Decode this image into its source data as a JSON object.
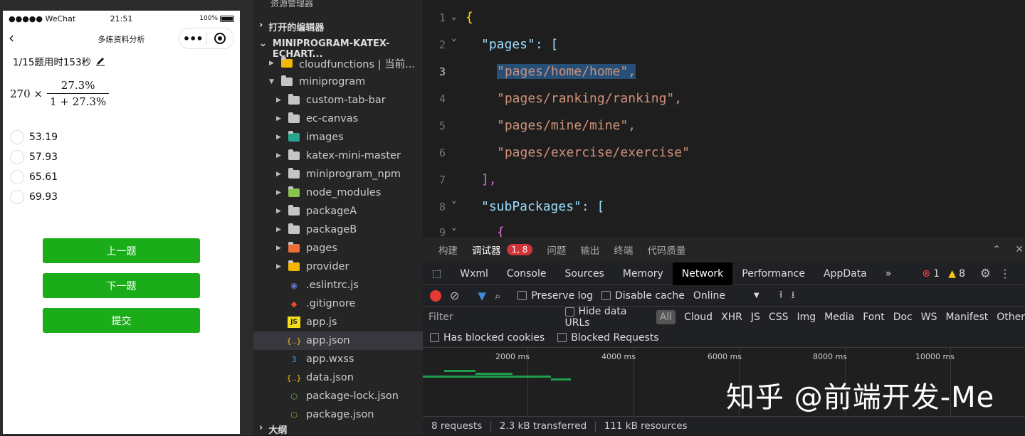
{
  "simulator": {
    "statusbar": {
      "carrier": "●●●●● WeChat",
      "time": "21:51",
      "battery": "100%"
    },
    "navbar": {
      "title": "多练资料分析",
      "back_icon": "chevron-left-icon",
      "more_icon": "more-dots-icon",
      "close_icon": "record-icon"
    },
    "question_info": "1/15题用时153秒",
    "formula": {
      "coef": "270 ×",
      "numerator": "27.3%",
      "denominator": "1 + 27.3%"
    },
    "options": [
      "53.19",
      "57.93",
      "65.61",
      "69.93"
    ],
    "buttons": {
      "prev": "上一题",
      "next": "下一题",
      "submit": "提交"
    }
  },
  "explorer": {
    "header": "资源管理器",
    "more": "···",
    "open_editors": "打开的编辑器",
    "project": "MINIPROGRAM-KATEX-ECHART...",
    "outline": "大纲",
    "tree": [
      {
        "label": "cloudfunctions | 当前...",
        "kind": "folder-yellow",
        "level": 0,
        "expanded": false
      },
      {
        "label": "miniprogram",
        "kind": "folder-open",
        "level": 0,
        "expanded": true
      },
      {
        "label": "custom-tab-bar",
        "kind": "folder",
        "level": 1,
        "expanded": false
      },
      {
        "label": "ec-canvas",
        "kind": "folder",
        "level": 1,
        "expanded": false
      },
      {
        "label": "images",
        "kind": "folder-teal",
        "level": 1,
        "expanded": false
      },
      {
        "label": "katex-mini-master",
        "kind": "folder",
        "level": 1,
        "expanded": false
      },
      {
        "label": "miniprogram_npm",
        "kind": "folder",
        "level": 1,
        "expanded": false
      },
      {
        "label": "node_modules",
        "kind": "folder-green",
        "level": 1,
        "expanded": false
      },
      {
        "label": "packageA",
        "kind": "folder",
        "level": 1,
        "expanded": false
      },
      {
        "label": "packageB",
        "kind": "folder",
        "level": 1,
        "expanded": false
      },
      {
        "label": "pages",
        "kind": "folder-orange",
        "level": 1,
        "expanded": false
      },
      {
        "label": "provider",
        "kind": "folder-yellow",
        "level": 1,
        "expanded": false
      },
      {
        "label": ".eslintrc.js",
        "kind": "eslint",
        "level": 1
      },
      {
        "label": ".gitignore",
        "kind": "git",
        "level": 1
      },
      {
        "label": "app.js",
        "kind": "js",
        "level": 1
      },
      {
        "label": "app.json",
        "kind": "json",
        "level": 1,
        "selected": true
      },
      {
        "label": "app.wxss",
        "kind": "css",
        "level": 1
      },
      {
        "label": "data.json",
        "kind": "json",
        "level": 1
      },
      {
        "label": "package-lock.json",
        "kind": "node",
        "level": 1
      },
      {
        "label": "package.json",
        "kind": "node",
        "level": 1
      }
    ]
  },
  "editor": {
    "lines": [
      {
        "n": "1",
        "text": "{"
      },
      {
        "n": "2",
        "text": "\"pages\": ["
      },
      {
        "n": "3",
        "text": "\"pages/home/home\","
      },
      {
        "n": "4",
        "text": "\"pages/ranking/ranking\","
      },
      {
        "n": "5",
        "text": "\"pages/mine/mine\","
      },
      {
        "n": "6",
        "text": "\"pages/exercise/exercise\""
      },
      {
        "n": "7",
        "text": "],"
      },
      {
        "n": "8",
        "text": "\"subPackages\": ["
      },
      {
        "n": "9",
        "text": "{"
      }
    ]
  },
  "devtools": {
    "tabs": [
      "构建",
      "调试器",
      "问题",
      "输出",
      "终端",
      "代码质量"
    ],
    "active_tab": "调试器",
    "error_badge": "1, 8",
    "panels": [
      "Wxml",
      "Console",
      "Sources",
      "Memory",
      "Network",
      "Performance",
      "AppData"
    ],
    "active_panel": "Network",
    "more_panels": "»",
    "errors": "1",
    "warnings": "8",
    "preserve_log": "Preserve log",
    "disable_cache": "Disable cache",
    "throttle": "Online",
    "filter_placeholder": "Filter",
    "hide_data_urls": "Hide data URLs",
    "types": [
      "All",
      "Cloud",
      "XHR",
      "JS",
      "CSS",
      "Img",
      "Media",
      "Font",
      "Doc",
      "WS",
      "Manifest",
      "Other"
    ],
    "has_blocked_cookies": "Has blocked cookies",
    "blocked_requests": "Blocked Requests",
    "timeline_ticks": [
      "2000 ms",
      "4000 ms",
      "6000 ms",
      "8000 ms",
      "10000 ms"
    ],
    "status": {
      "requests": "8 requests",
      "transferred": "2.3 kB transferred",
      "resources": "111 kB resources"
    }
  },
  "watermark": "知乎 @前端开发-Me"
}
